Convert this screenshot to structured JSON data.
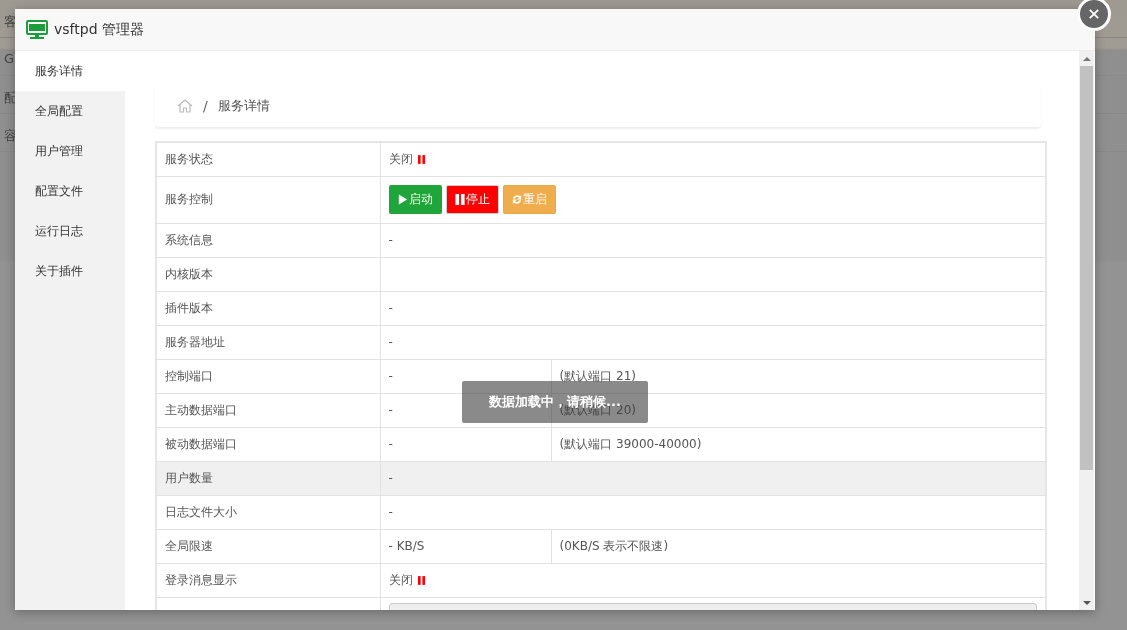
{
  "background_page": {
    "fragments": [
      "客",
      "G",
      "配",
      "容"
    ]
  },
  "window": {
    "title": "vsftpd 管理器"
  },
  "sidebar": {
    "items": [
      {
        "label": "服务详情",
        "selected": true
      },
      {
        "label": "全局配置",
        "selected": false
      },
      {
        "label": "用户管理",
        "selected": false
      },
      {
        "label": "配置文件",
        "selected": false
      },
      {
        "label": "运行日志",
        "selected": false
      },
      {
        "label": "关于插件",
        "selected": false
      }
    ]
  },
  "breadcrumb": {
    "separator": "/",
    "current": "服务详情"
  },
  "table": {
    "rows": [
      {
        "kind": "status",
        "label": "服务状态",
        "value": "关闭",
        "running": false
      },
      {
        "kind": "buttons",
        "label": "服务控制",
        "buttons": [
          {
            "label": "启动",
            "kind": "start"
          },
          {
            "label": "停止",
            "kind": "stop"
          },
          {
            "label": "重启",
            "kind": "restart"
          }
        ]
      },
      {
        "kind": "text",
        "label": "系统信息",
        "value": "-"
      },
      {
        "kind": "text",
        "label": "内核版本"
      },
      {
        "kind": "text",
        "label": "插件版本",
        "value": "-"
      },
      {
        "kind": "text",
        "label": "服务器地址",
        "value": "-"
      },
      {
        "kind": "text",
        "label": "控制端口",
        "value": "-",
        "note": "(默认端口 21)"
      },
      {
        "kind": "text",
        "label": "主动数据端口",
        "value": "-",
        "note": "(默认端口 20)"
      },
      {
        "kind": "text",
        "label": "被动数据端口",
        "value": "-",
        "note": "(默认端口 39000-40000)"
      },
      {
        "kind": "text",
        "label": "用户数量",
        "value": "-",
        "highlighted": true
      },
      {
        "kind": "text",
        "label": "日志文件大小",
        "value": "-"
      },
      {
        "kind": "text",
        "label": "全局限速",
        "value": "- KB/S",
        "note": "(0KB/S 表示不限速)"
      },
      {
        "kind": "status",
        "label": "登录消息显示",
        "value": "关闭",
        "running": false
      },
      {
        "kind": "input"
      }
    ]
  },
  "loading_toast": {
    "text": "数据加载中，请稍候..."
  }
}
